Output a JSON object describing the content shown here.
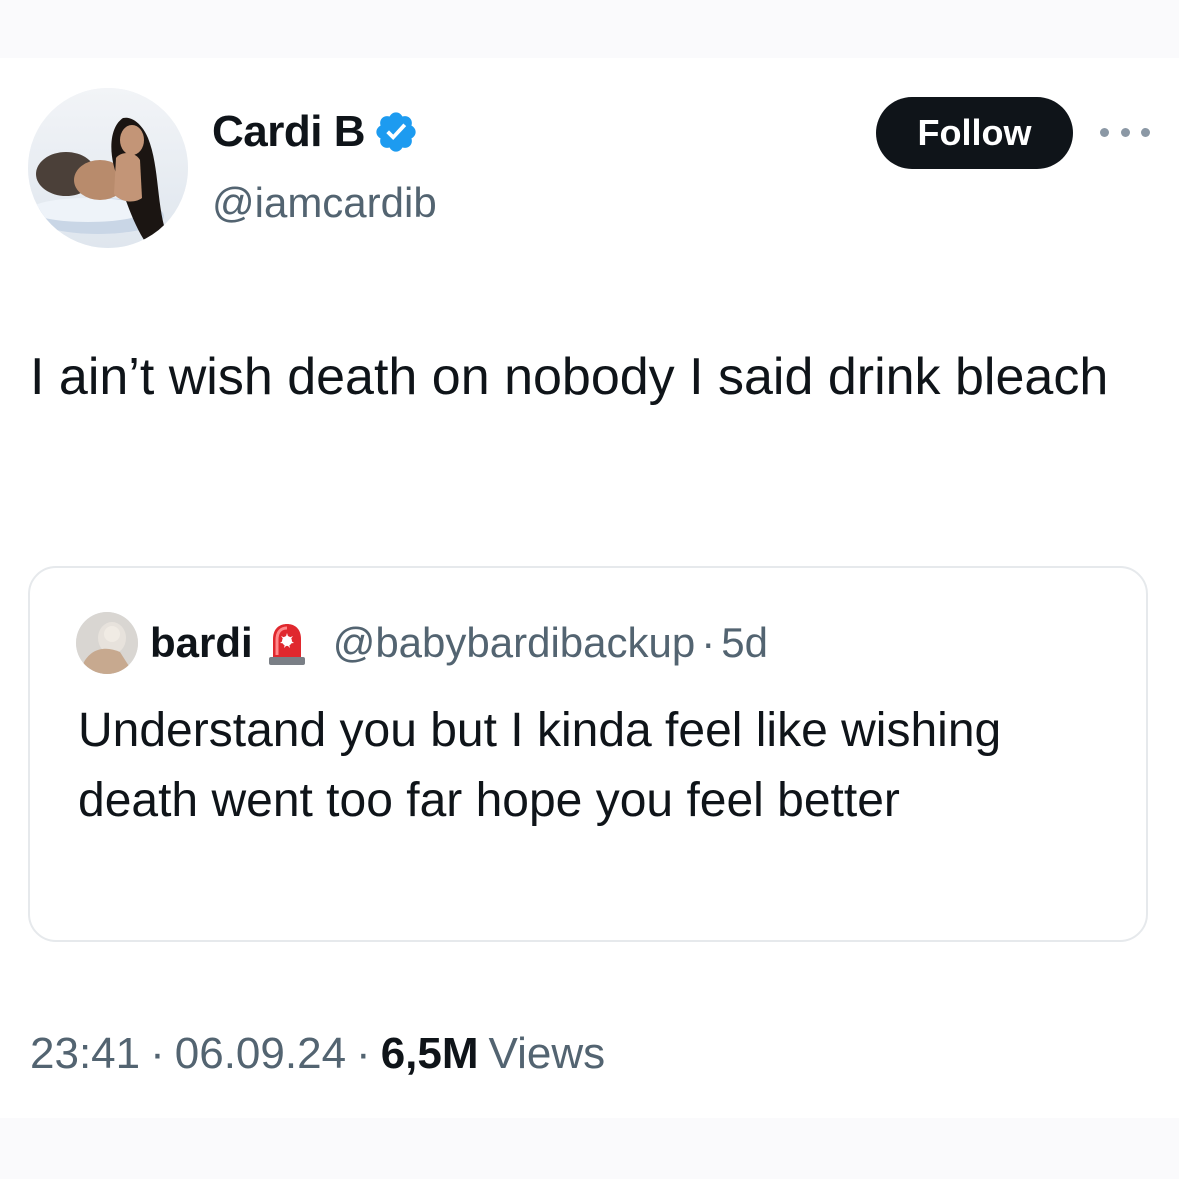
{
  "author": {
    "display_name": "Cardi B",
    "handle": "@iamcardib",
    "verified_icon": "verified-badge-icon",
    "verified_color": "#1d9bf0"
  },
  "actions": {
    "follow_label": "Follow",
    "more_icon": "more-horizontal-icon"
  },
  "tweet": {
    "text": "I ain’t wish death on nobody I said drink bleach"
  },
  "quoted": {
    "display_name": "bardi",
    "badge_icon": "police-siren-emoji",
    "handle": "@babybardibackup",
    "separator": "·",
    "time": "5d",
    "text": "Understand you but I kinda feel like wishing death went too far hope you feel better"
  },
  "meta": {
    "time": "23:41",
    "date": "06.09.24",
    "separator": "·",
    "views_count": "6,5M",
    "views_label": "Views"
  },
  "colors": {
    "text_primary": "#0f1419",
    "text_secondary": "#536471",
    "border": "#e6e9ec",
    "follow_bg": "#0f1419",
    "follow_text": "#ffffff"
  }
}
